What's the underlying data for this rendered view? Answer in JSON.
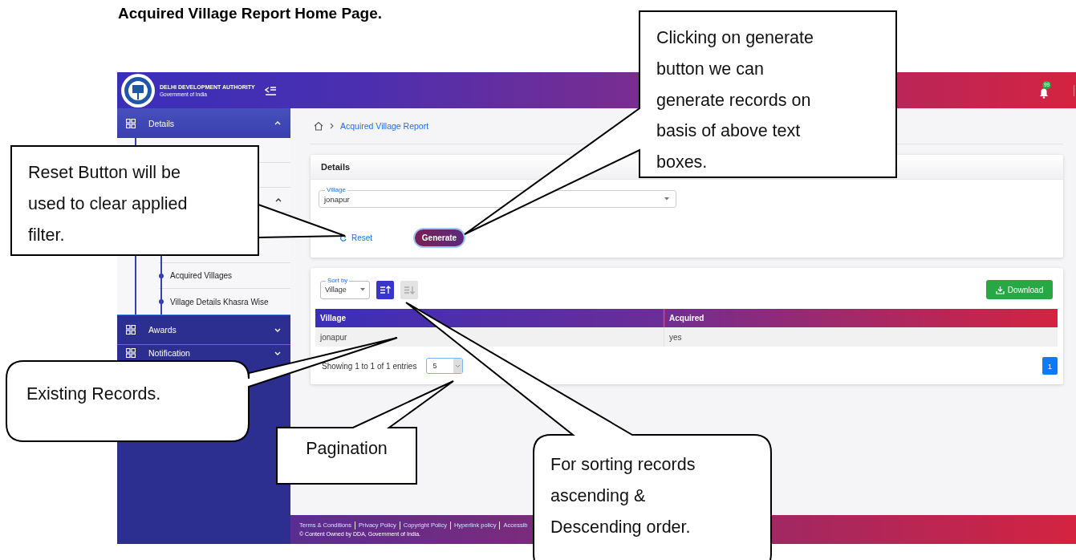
{
  "document": {
    "heading": "Acquired Village Report Home Page."
  },
  "header": {
    "org_name": "DELHI DEVELOPMENT AUTHORITY",
    "org_subtitle": "Government of India",
    "notification_count": "99"
  },
  "sidebar": {
    "items": [
      {
        "label": "Details",
        "expanded": true,
        "children": [
          {
            "expanded": true,
            "children": [
              {
                "label": "Acquired Villages"
              },
              {
                "label": "Village Details Khasra Wise"
              }
            ]
          }
        ]
      },
      {
        "label": "Awards",
        "expanded": false
      },
      {
        "label": "Notification",
        "expanded": false
      }
    ]
  },
  "breadcrumb": {
    "items": [
      "Acquired Village Report"
    ]
  },
  "details_card": {
    "title": "Details",
    "village_field": {
      "label": "Village",
      "value": "jonapur"
    },
    "reset_button": "Reset",
    "generate_button": "Generate"
  },
  "results": {
    "sort_field": {
      "label": "Sort by",
      "value": "Village"
    },
    "sort_buttons": [
      {
        "kind": "ascending",
        "selected": true
      },
      {
        "kind": "descending",
        "selected": false
      }
    ],
    "download_button": "Download",
    "table": {
      "columns": [
        "Village",
        "Acquired"
      ],
      "rows": [
        [
          "jonapur",
          "yes"
        ]
      ]
    },
    "entries_info": "Showing 1 to 1 of 1 entries",
    "page_size": "5",
    "pages": [
      {
        "label": "1",
        "selected": true
      }
    ]
  },
  "footer": {
    "links": [
      "Terms & Conditions",
      "Privacy Policy",
      "Copyright Policy",
      "Hyperlink policy",
      "Accessib"
    ],
    "copyright": "© Content Owned by DDA, Government of India."
  },
  "callouts": [
    {
      "kind": "rect",
      "lines": [
        "Clicking on generate",
        "button we can",
        "generate records on",
        "basis of above text",
        "boxes."
      ]
    },
    {
      "kind": "rect",
      "lines": [
        "Reset Button will be",
        "used to clear applied",
        "filter."
      ]
    },
    {
      "kind": "rounded",
      "lines": [
        "Existing Records."
      ]
    },
    {
      "kind": "rect",
      "lines": [
        "Pagination"
      ]
    },
    {
      "kind": "rounded",
      "lines": [
        "For sorting records",
        "ascending &",
        "Descending order."
      ]
    }
  ]
}
